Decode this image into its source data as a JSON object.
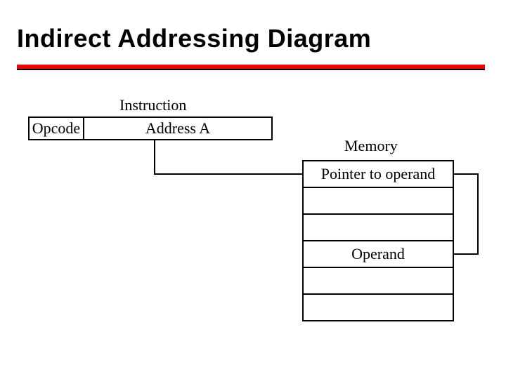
{
  "title": "Indirect Addressing Diagram",
  "labels": {
    "instruction": "Instruction",
    "opcode": "Opcode",
    "address": "Address A",
    "memory": "Memory",
    "pointer": "Pointer to operand",
    "operand": "Operand"
  }
}
